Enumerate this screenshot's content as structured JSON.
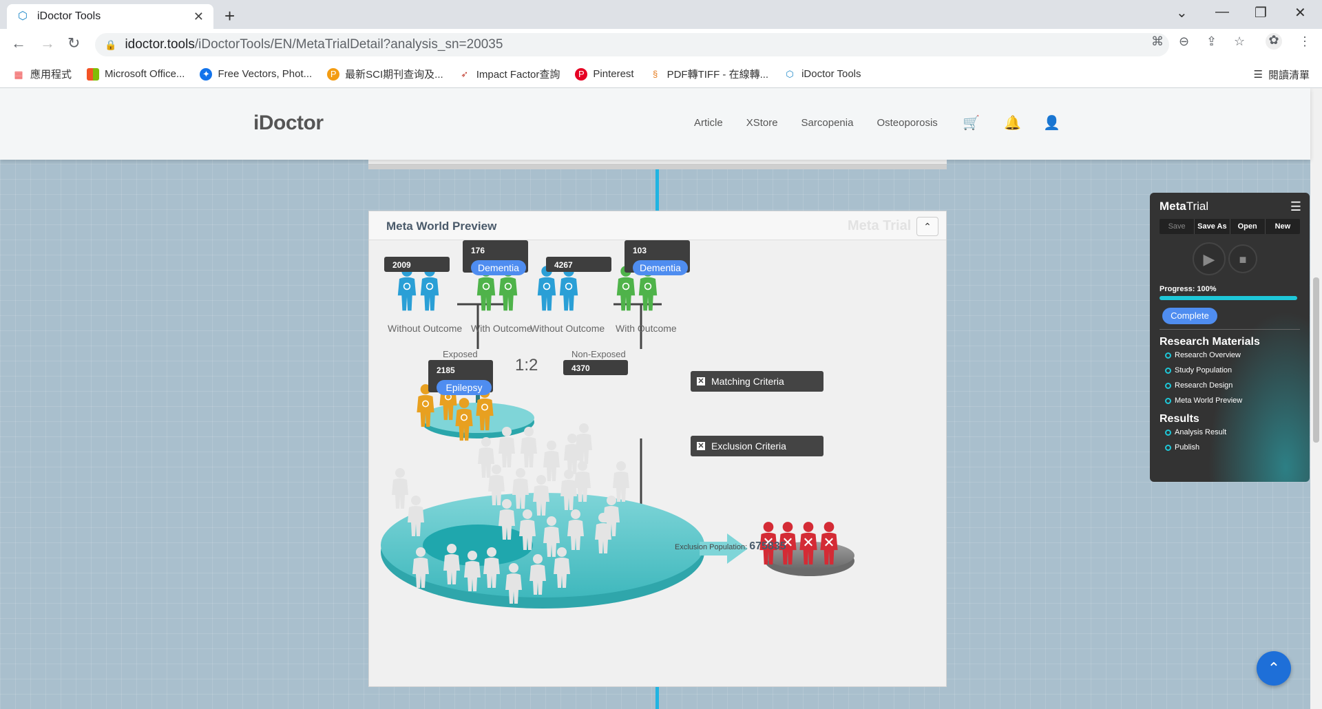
{
  "browser": {
    "tab_title": "iDoctor Tools",
    "url_host": "idoctor.tools",
    "url_path": "/iDoctorTools/EN/MetaTrialDetail?analysis_sn=20035",
    "bookmarks": [
      {
        "label": "應用程式",
        "icon": "apps-grid-icon"
      },
      {
        "label": "Microsoft Office...",
        "icon": "microsoft-icon"
      },
      {
        "label": "Free Vectors, Phot...",
        "icon": "freepik-icon"
      },
      {
        "label": "最新SCI期刊查询及...",
        "icon": "p-icon"
      },
      {
        "label": "Impact Factor查詢",
        "icon": "rocket-icon"
      },
      {
        "label": "Pinterest",
        "icon": "pinterest-icon"
      },
      {
        "label": "PDF轉TIFF - 在線轉...",
        "icon": "pdf-icon"
      },
      {
        "label": "iDoctor Tools",
        "icon": "idoctor-icon"
      }
    ],
    "reading_list": "閱讀清單"
  },
  "header": {
    "logo": "iDoctor",
    "nav": [
      "Article",
      "XStore",
      "Sarcopenia",
      "Osteoporosis"
    ]
  },
  "card": {
    "title": "Meta World Preview",
    "watermark": "Meta Trial",
    "exposed": {
      "without_count": "2009",
      "with_count": "176",
      "outcome": "Dementia",
      "without_label": "Without Outcome",
      "with_label": "With Outcome",
      "group_label": "Exposed",
      "group_count": "2185",
      "group_tag": "Epilepsy"
    },
    "ratio": "1:2",
    "nonexposed": {
      "without_count": "4267",
      "with_count": "103",
      "outcome": "Dementia",
      "without_label": "Without Outcome",
      "with_label": "With Outcome",
      "group_label": "Non-Exposed",
      "group_count": "4370"
    },
    "matching_criteria": "Matching Criteria",
    "exclusion_criteria": "Exclusion Criteria",
    "exclusion_population_label": "Exclusion Population:",
    "exclusion_population": "675835"
  },
  "metatrial": {
    "title_bold": "Meta",
    "title_rest": "Trial",
    "buttons": [
      "Save",
      "Save As",
      "Open",
      "New"
    ],
    "progress_label": "Progress: 100%",
    "progress": 1.0,
    "status": "Complete",
    "research_materials": "Research Materials",
    "research_items": [
      "Research Overview",
      "Study Population",
      "Research Design",
      "Meta World Preview"
    ],
    "results": "Results",
    "results_items": [
      "Analysis Result",
      "Publish"
    ]
  },
  "colors": {
    "accent": "#4f8df0",
    "cyan": "#1ec7d8",
    "blue_person": "#2a9fd6",
    "green_person": "#4fb34a",
    "orange_person": "#e8a020",
    "red_person": "#d42b35"
  }
}
